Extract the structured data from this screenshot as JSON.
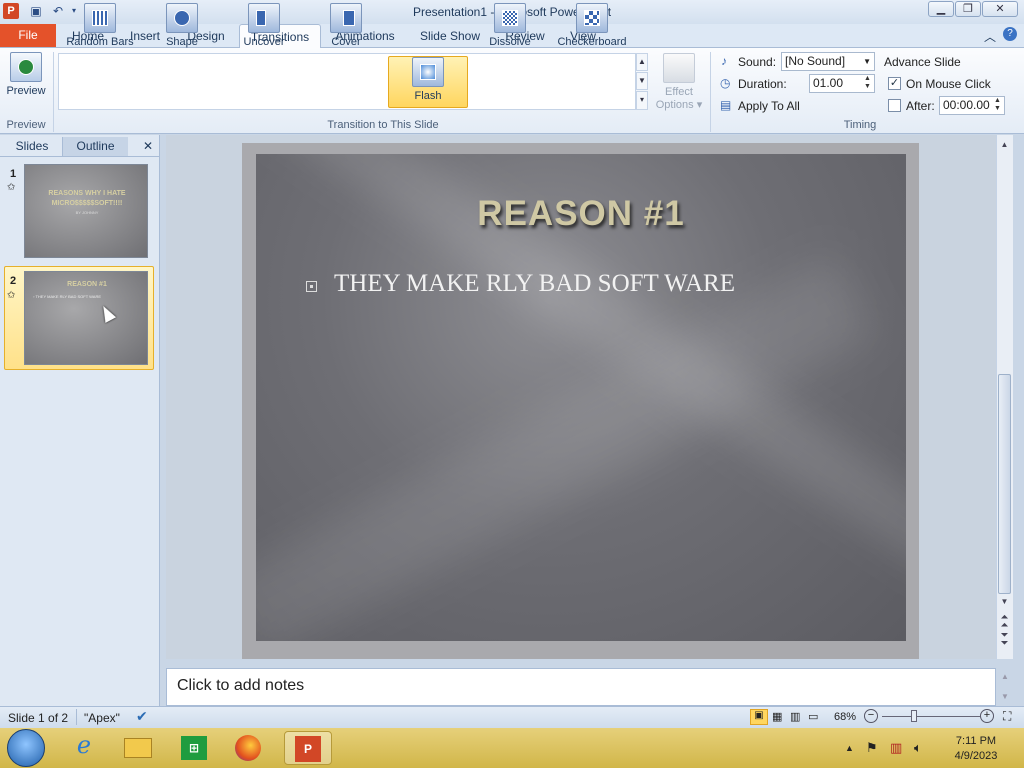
{
  "titlebar": {
    "title": "Presentation1  -  Microsoft PowerPoint",
    "app_icon": "P",
    "qat": [
      "save-icon",
      "undo-icon",
      "undo-dropdown-icon",
      "redo-icon",
      "customize-qat-icon"
    ],
    "window_buttons": {
      "minimize": "▁",
      "maximize": "❐",
      "close": "✕"
    }
  },
  "tabs": {
    "file": "File",
    "items": [
      "Home",
      "Insert",
      "Design",
      "Transitions",
      "Animations",
      "Slide Show",
      "Review",
      "View"
    ],
    "active": "Transitions",
    "minimize_ribbon": "︿",
    "help": "?"
  },
  "ribbon": {
    "preview": {
      "label": "Preview",
      "group": "Preview"
    },
    "gallery": {
      "group": "Transition to This Slide",
      "items": [
        "Random Bars",
        "Shape",
        "Uncover",
        "Cover",
        "Flash",
        "Dissolve",
        "Checkerboard"
      ],
      "selected": "Flash"
    },
    "effect_options": {
      "line1": "Effect",
      "line2": "Options"
    },
    "timing": {
      "group": "Timing",
      "sound_label": "Sound:",
      "sound_value": "[No Sound]",
      "duration_label": "Duration:",
      "duration_value": "01.00",
      "apply_all": "Apply To All",
      "advance_label": "Advance Slide",
      "on_click_label": "On Mouse Click",
      "on_click_checked": true,
      "after_label": "After:",
      "after_value": "00:00.00",
      "after_checked": false
    }
  },
  "left_pane": {
    "tabs": [
      "Slides",
      "Outline"
    ],
    "active": "Slides",
    "close": "✕",
    "slides": [
      {
        "number": "1",
        "title": "REASONS  WHY I HATE MICRO$$$$$SOFT!!!!",
        "sub": "BY JOHNNY"
      },
      {
        "number": "2",
        "title": "REASON #1",
        "sub": "▫ THEY MAKE RLY BAD SOFT WARE"
      }
    ],
    "transition_icon": "✩"
  },
  "slide": {
    "title": "REASON #1",
    "bullet": "THEY MAKE RLY BAD SOFT WARE"
  },
  "notes": {
    "placeholder": "Click to add notes"
  },
  "statusbar": {
    "slide_info": "Slide 1 of 2",
    "theme": "\"Apex\"",
    "zoom": "68%",
    "zoom_level_percent": 68
  },
  "taskbar": {
    "time": "7:11 PM",
    "date": "4/9/2023"
  },
  "colors": {
    "file_tab": "#e4522a",
    "selected_transition": "#ffd65f",
    "slide_title": "#cfc8a4"
  }
}
